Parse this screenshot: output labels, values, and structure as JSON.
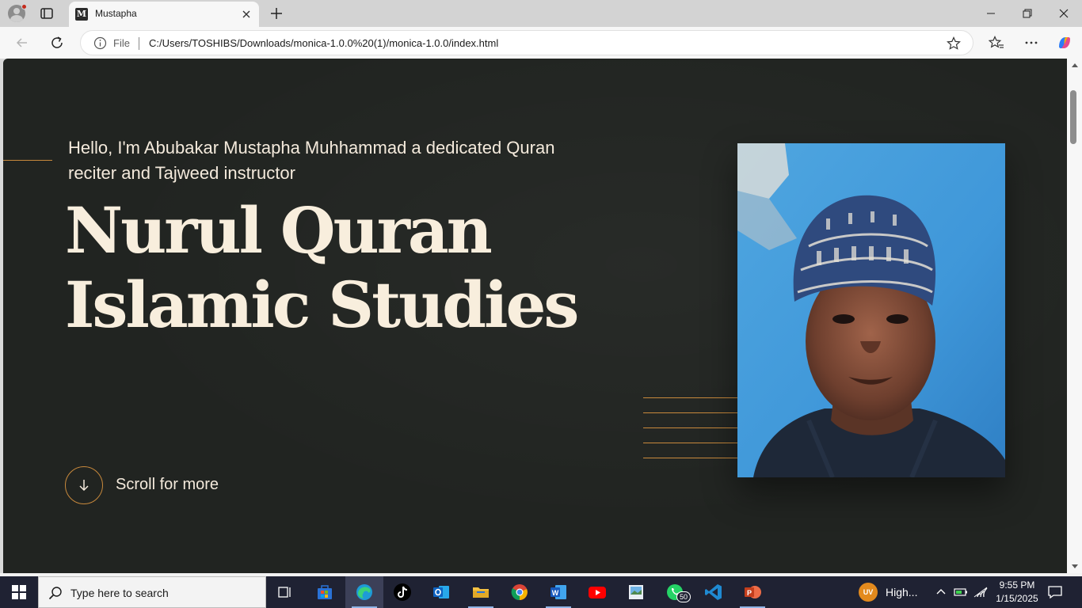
{
  "browser": {
    "tab": {
      "favicon_letter": "M",
      "title": "Mustapha"
    },
    "address": {
      "scheme_label": "File",
      "url": "C:/Users/TOSHIBS/Downloads/monica-1.0.0%20(1)/monica-1.0.0/index.html"
    },
    "icons": [
      "profile-icon",
      "tab-actions-icon",
      "close-icon",
      "new-tab-icon",
      "minimize-icon",
      "restore-icon",
      "back-icon",
      "refresh-icon",
      "info-icon",
      "favorite-star-icon",
      "favorites-icon",
      "more-icon",
      "copilot-icon"
    ]
  },
  "page": {
    "intro": "Hello, I'm Abubakar Mustapha Muhhammad a dedicated Quran reciter and Tajweed instructor",
    "headline": {
      "line1": "Nurul Quran",
      "line2": "Islamic Studies"
    },
    "scroll_label": "Scroll for more",
    "accent_color": "#c8893c",
    "background_color": "#212421",
    "text_color": "#f8eedd"
  },
  "taskbar": {
    "search_placeholder": "Type here to search",
    "apps": [
      "task-view",
      "microsoft-store",
      "edge",
      "tiktok",
      "outlook",
      "file-explorer",
      "chrome",
      "word",
      "youtube",
      "photos",
      "whatsapp",
      "vscode",
      "powerpoint"
    ],
    "whatsapp_badge": "50",
    "weather": {
      "badge": "UV",
      "text": "High..."
    },
    "clock": {
      "time": "9:55 PM",
      "date": "1/15/2025"
    }
  }
}
